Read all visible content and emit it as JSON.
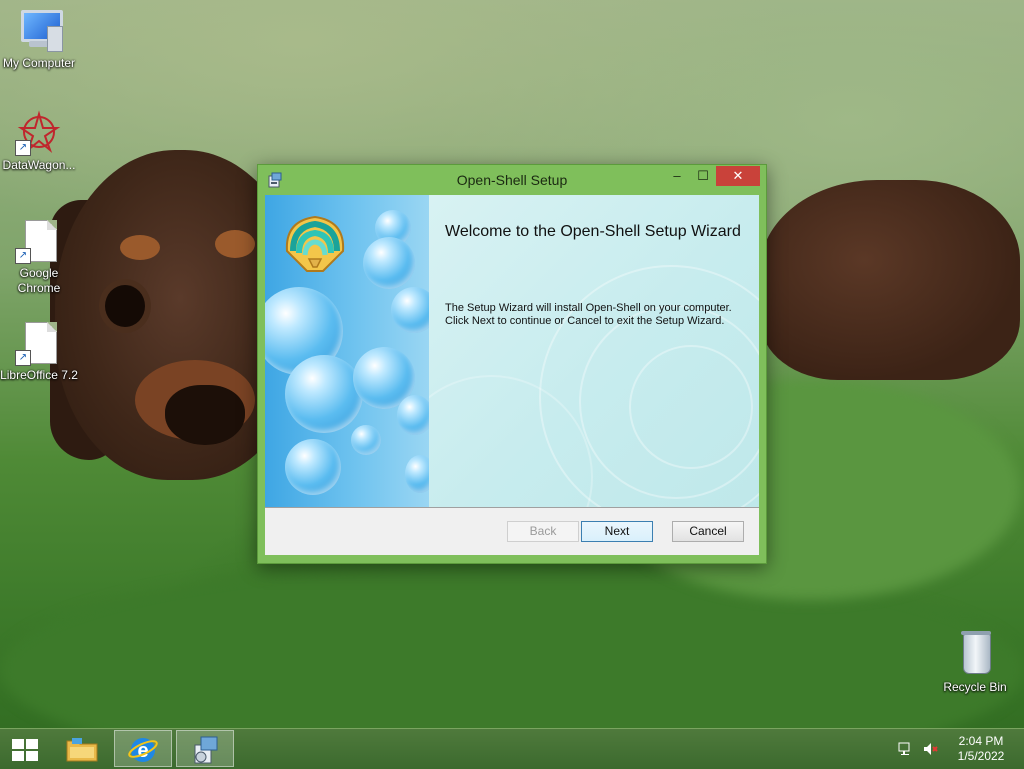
{
  "desktop": {
    "icons": [
      {
        "label": "My Computer"
      },
      {
        "label": "DataWagon..."
      },
      {
        "label": "Google Chrome"
      },
      {
        "label": "LibreOffice 7.2"
      },
      {
        "label": "Recycle Bin"
      }
    ]
  },
  "window": {
    "title": "Open-Shell Setup",
    "controls": {
      "minimize": "–",
      "maximize": "☐",
      "close": "✕"
    },
    "heading": "Welcome to the Open-Shell Setup Wizard",
    "body_line1": "The Setup Wizard will install Open-Shell on your computer.",
    "body_line2": "Click Next to continue or Cancel to exit the Setup Wizard.",
    "buttons": {
      "back": "Back",
      "next": "Next",
      "cancel": "Cancel"
    }
  },
  "taskbar": {
    "items": [
      "start-button",
      "file-explorer",
      "internet-explorer",
      "setup-installer"
    ],
    "tray": {
      "network_icon": "network-icon",
      "volume_icon": "volume-muted-icon"
    },
    "clock": {
      "time": "2:04 PM",
      "date": "1/5/2022"
    }
  }
}
